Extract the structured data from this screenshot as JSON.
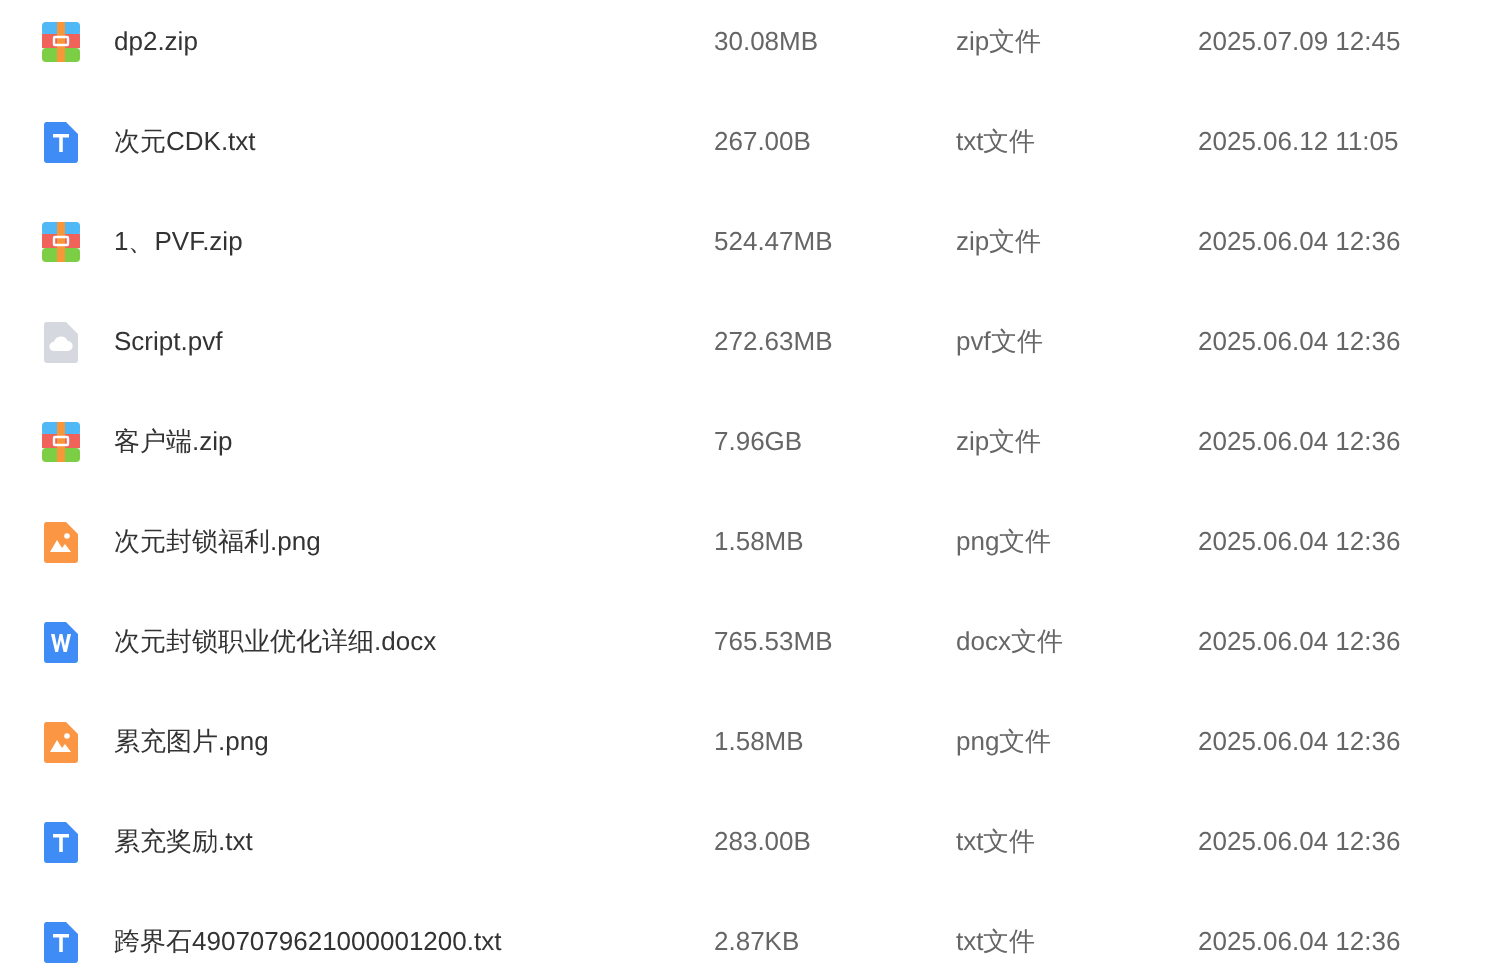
{
  "files": [
    {
      "kind": "zip",
      "name": "dp2.zip",
      "size": "30.08MB",
      "type": "zip文件",
      "modified": "2025.07.09 12:45"
    },
    {
      "kind": "txt",
      "name": "次元CDK.txt",
      "size": "267.00B",
      "type": "txt文件",
      "modified": "2025.06.12 11:05"
    },
    {
      "kind": "zip",
      "name": "1、PVF.zip",
      "size": "524.47MB",
      "type": "zip文件",
      "modified": "2025.06.04 12:36"
    },
    {
      "kind": "other",
      "name": "Script.pvf",
      "size": "272.63MB",
      "type": "pvf文件",
      "modified": "2025.06.04 12:36"
    },
    {
      "kind": "zip",
      "name": "客户端.zip",
      "size": "7.96GB",
      "type": "zip文件",
      "modified": "2025.06.04 12:36"
    },
    {
      "kind": "image",
      "name": "次元封锁福利.png",
      "size": "1.58MB",
      "type": "png文件",
      "modified": "2025.06.04 12:36"
    },
    {
      "kind": "doc",
      "name": "次元封锁职业优化详细.docx",
      "size": "765.53MB",
      "type": "docx文件",
      "modified": "2025.06.04 12:36"
    },
    {
      "kind": "image",
      "name": "累充图片.png",
      "size": "1.58MB",
      "type": "png文件",
      "modified": "2025.06.04 12:36"
    },
    {
      "kind": "txt",
      "name": "累充奖励.txt",
      "size": "283.00B",
      "type": "txt文件",
      "modified": "2025.06.04 12:36"
    },
    {
      "kind": "txt",
      "name": "跨界石4907079621000001200.txt",
      "size": "2.87KB",
      "type": "txt文件",
      "modified": "2025.06.04 12:36"
    }
  ]
}
